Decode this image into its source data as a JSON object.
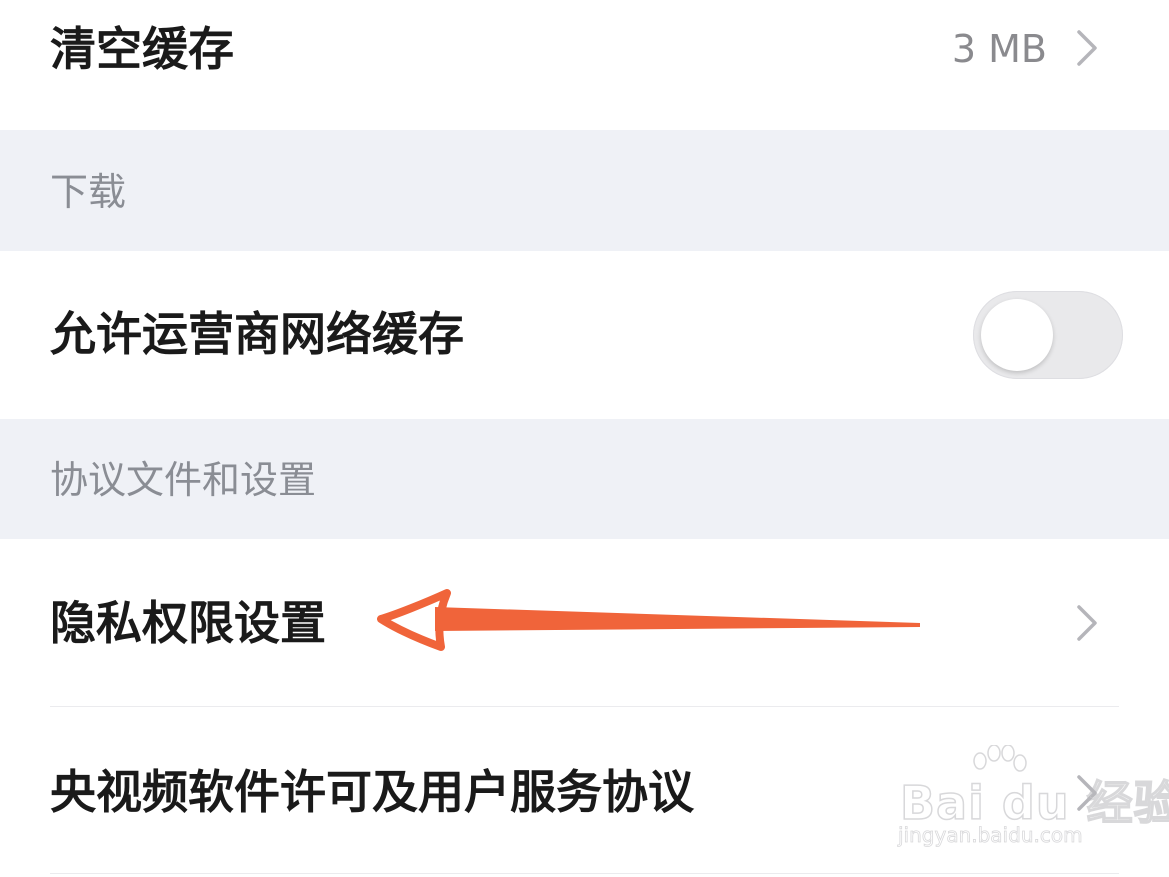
{
  "rows": {
    "clear_cache": {
      "label": "清空缓存",
      "value": "3 MB"
    },
    "cellular_cache": {
      "label": "允许运营商网络缓存",
      "toggle_on": false
    },
    "privacy": {
      "label": "隐私权限设置"
    },
    "license": {
      "label": "央视频软件许可及用户服务协议"
    }
  },
  "sections": {
    "download": "下载",
    "agreements": "协议文件和设置"
  },
  "icons": {
    "chevron": "chevron-right-icon",
    "arrow": "arrow-left-annotation-icon"
  },
  "colors": {
    "section_bg": "#eff1f6",
    "annotation": "#f0643a",
    "toggle_off": "#e9e9eb"
  },
  "watermark": {
    "brand": "Bai du 经验",
    "url": "jingyan.baidu.com"
  }
}
